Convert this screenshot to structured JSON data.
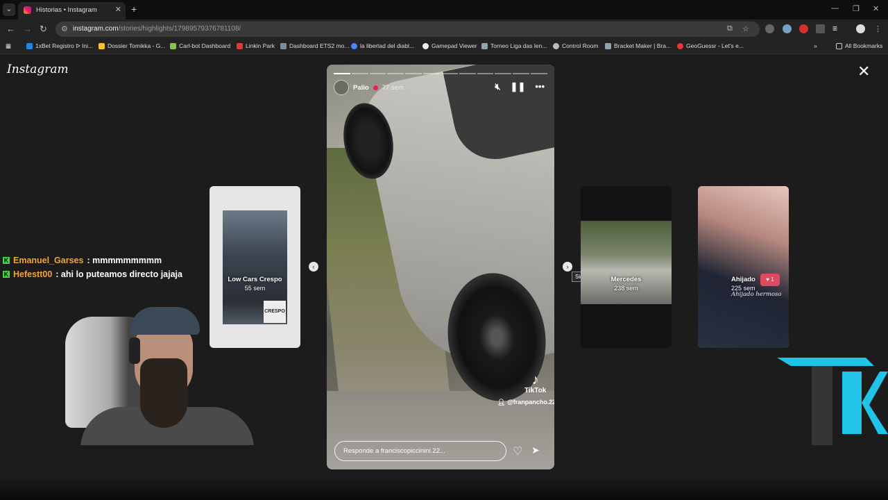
{
  "browser": {
    "tab_title": "Historias • Instagram",
    "url_host": "instagram.com",
    "url_path": "/stories/highlights/17989579376781108/",
    "bookmarks": [
      {
        "label": "1xBet Registro ᐅ Ini...",
        "color": "#1e88e5"
      },
      {
        "label": "Dossier Tomikka - G...",
        "color": "#fbc02d"
      },
      {
        "label": "Carl-bot Dashboard",
        "color": "#8bc34a"
      },
      {
        "label": "Linkin Park",
        "color": "#e53935"
      },
      {
        "label": "Dashboard ETS2 mo...",
        "color": "#78909c"
      },
      {
        "label": "la libertad del diabl...",
        "color": "#4285f4"
      },
      {
        "label": "Gamepad Viewer",
        "color": "#eeeeee"
      },
      {
        "label": "Torneo Liga das len...",
        "color": "#90a4ae"
      },
      {
        "label": "Control Room",
        "color": "#bdbdbd"
      },
      {
        "label": "Bracket Maker | Bra...",
        "color": "#90a4ae"
      },
      {
        "label": "GeoGuessr - Let's e...",
        "color": "#e53935"
      }
    ],
    "all_bookmarks": "All Bookmarks"
  },
  "instagram": {
    "logo": "Instagram",
    "story": {
      "user": "Palio",
      "time": "77 sem",
      "reply_placeholder": "Responde a franciscopiccinini.22...",
      "tiktok_label": "TikTok",
      "tiktok_user": "@franpancho.22",
      "progress_segments": 12,
      "progress_done": 1
    },
    "next_tooltip": "Siguiente",
    "side_stories": [
      {
        "name": "Low Cars Crespo",
        "time": "55 sem",
        "logo_text": "CRESPO"
      },
      {
        "name": "Mercedes",
        "time": "238 sem"
      },
      {
        "name": "Ahijado",
        "time": "225 sem",
        "sticker": "1",
        "handwriting": "Ahijado hermoso"
      }
    ]
  },
  "chat": [
    {
      "user": "Emanuel_Garses",
      "message": ": mmmmmmmmm"
    },
    {
      "user": "Hefestt00",
      "message": ": ahi lo puteamos directo jajaja"
    }
  ]
}
